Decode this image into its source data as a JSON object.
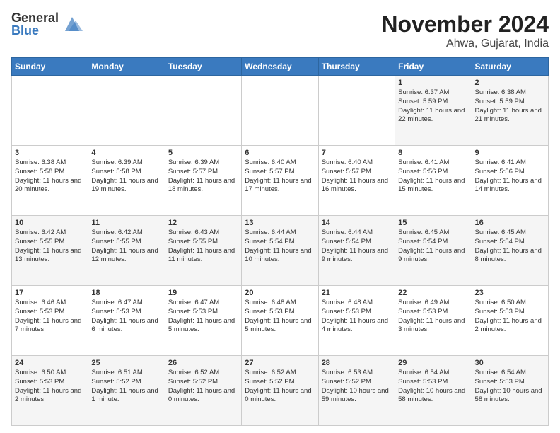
{
  "logo": {
    "general": "General",
    "blue": "Blue"
  },
  "title": {
    "month": "November 2024",
    "location": "Ahwa, Gujarat, India"
  },
  "headers": [
    "Sunday",
    "Monday",
    "Tuesday",
    "Wednesday",
    "Thursday",
    "Friday",
    "Saturday"
  ],
  "weeks": [
    [
      {
        "day": "",
        "info": ""
      },
      {
        "day": "",
        "info": ""
      },
      {
        "day": "",
        "info": ""
      },
      {
        "day": "",
        "info": ""
      },
      {
        "day": "",
        "info": ""
      },
      {
        "day": "1",
        "info": "Sunrise: 6:37 AM\nSunset: 5:59 PM\nDaylight: 11 hours and 22 minutes."
      },
      {
        "day": "2",
        "info": "Sunrise: 6:38 AM\nSunset: 5:59 PM\nDaylight: 11 hours and 21 minutes."
      }
    ],
    [
      {
        "day": "3",
        "info": "Sunrise: 6:38 AM\nSunset: 5:58 PM\nDaylight: 11 hours and 20 minutes."
      },
      {
        "day": "4",
        "info": "Sunrise: 6:39 AM\nSunset: 5:58 PM\nDaylight: 11 hours and 19 minutes."
      },
      {
        "day": "5",
        "info": "Sunrise: 6:39 AM\nSunset: 5:57 PM\nDaylight: 11 hours and 18 minutes."
      },
      {
        "day": "6",
        "info": "Sunrise: 6:40 AM\nSunset: 5:57 PM\nDaylight: 11 hours and 17 minutes."
      },
      {
        "day": "7",
        "info": "Sunrise: 6:40 AM\nSunset: 5:57 PM\nDaylight: 11 hours and 16 minutes."
      },
      {
        "day": "8",
        "info": "Sunrise: 6:41 AM\nSunset: 5:56 PM\nDaylight: 11 hours and 15 minutes."
      },
      {
        "day": "9",
        "info": "Sunrise: 6:41 AM\nSunset: 5:56 PM\nDaylight: 11 hours and 14 minutes."
      }
    ],
    [
      {
        "day": "10",
        "info": "Sunrise: 6:42 AM\nSunset: 5:55 PM\nDaylight: 11 hours and 13 minutes."
      },
      {
        "day": "11",
        "info": "Sunrise: 6:42 AM\nSunset: 5:55 PM\nDaylight: 11 hours and 12 minutes."
      },
      {
        "day": "12",
        "info": "Sunrise: 6:43 AM\nSunset: 5:55 PM\nDaylight: 11 hours and 11 minutes."
      },
      {
        "day": "13",
        "info": "Sunrise: 6:44 AM\nSunset: 5:54 PM\nDaylight: 11 hours and 10 minutes."
      },
      {
        "day": "14",
        "info": "Sunrise: 6:44 AM\nSunset: 5:54 PM\nDaylight: 11 hours and 9 minutes."
      },
      {
        "day": "15",
        "info": "Sunrise: 6:45 AM\nSunset: 5:54 PM\nDaylight: 11 hours and 9 minutes."
      },
      {
        "day": "16",
        "info": "Sunrise: 6:45 AM\nSunset: 5:54 PM\nDaylight: 11 hours and 8 minutes."
      }
    ],
    [
      {
        "day": "17",
        "info": "Sunrise: 6:46 AM\nSunset: 5:53 PM\nDaylight: 11 hours and 7 minutes."
      },
      {
        "day": "18",
        "info": "Sunrise: 6:47 AM\nSunset: 5:53 PM\nDaylight: 11 hours and 6 minutes."
      },
      {
        "day": "19",
        "info": "Sunrise: 6:47 AM\nSunset: 5:53 PM\nDaylight: 11 hours and 5 minutes."
      },
      {
        "day": "20",
        "info": "Sunrise: 6:48 AM\nSunset: 5:53 PM\nDaylight: 11 hours and 5 minutes."
      },
      {
        "day": "21",
        "info": "Sunrise: 6:48 AM\nSunset: 5:53 PM\nDaylight: 11 hours and 4 minutes."
      },
      {
        "day": "22",
        "info": "Sunrise: 6:49 AM\nSunset: 5:53 PM\nDaylight: 11 hours and 3 minutes."
      },
      {
        "day": "23",
        "info": "Sunrise: 6:50 AM\nSunset: 5:53 PM\nDaylight: 11 hours and 2 minutes."
      }
    ],
    [
      {
        "day": "24",
        "info": "Sunrise: 6:50 AM\nSunset: 5:53 PM\nDaylight: 11 hours and 2 minutes."
      },
      {
        "day": "25",
        "info": "Sunrise: 6:51 AM\nSunset: 5:52 PM\nDaylight: 11 hours and 1 minute."
      },
      {
        "day": "26",
        "info": "Sunrise: 6:52 AM\nSunset: 5:52 PM\nDaylight: 11 hours and 0 minutes."
      },
      {
        "day": "27",
        "info": "Sunrise: 6:52 AM\nSunset: 5:52 PM\nDaylight: 11 hours and 0 minutes."
      },
      {
        "day": "28",
        "info": "Sunrise: 6:53 AM\nSunset: 5:52 PM\nDaylight: 10 hours and 59 minutes."
      },
      {
        "day": "29",
        "info": "Sunrise: 6:54 AM\nSunset: 5:53 PM\nDaylight: 10 hours and 58 minutes."
      },
      {
        "day": "30",
        "info": "Sunrise: 6:54 AM\nSunset: 5:53 PM\nDaylight: 10 hours and 58 minutes."
      }
    ]
  ]
}
